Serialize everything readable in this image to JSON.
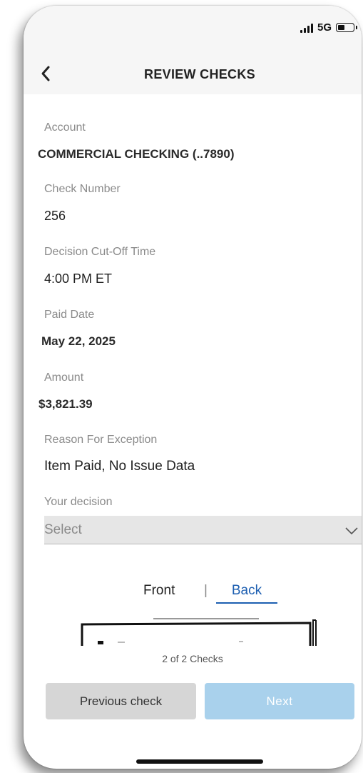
{
  "status": {
    "network": "5G",
    "battery_level": 0.45
  },
  "nav": {
    "title": "REVIEW CHECKS",
    "back_icon": "chevron-left-icon"
  },
  "fields": {
    "account_label": "Account",
    "account_value": "COMMERCIAL CHECKING (..7890)",
    "check_number_label": "Check Number",
    "check_number_value": "256",
    "cutoff_label": "Decision Cut-Off Time",
    "cutoff_value": "4:00 PM ET",
    "paid_date_label": "Paid Date",
    "paid_date_value": "May 22, 2025",
    "amount_label": "Amount",
    "amount_value": "$3,821.39",
    "reason_label": "Reason For Exception",
    "reason_value": "Item Paid, No Issue Data"
  },
  "decision": {
    "label": "Your decision",
    "placeholder": "Select"
  },
  "image_tabs": {
    "front": "Front",
    "separator": "|",
    "back": "Back",
    "selected": "Back"
  },
  "pager": {
    "text": "2 of 2 Checks"
  },
  "buttons": {
    "previous": "Previous check",
    "next": "Next"
  },
  "colors": {
    "accent": "#1d5fb1",
    "next_button": "#a9d1ec",
    "prev_button": "#d6d6d6",
    "select_bg": "#e6e6e6"
  }
}
